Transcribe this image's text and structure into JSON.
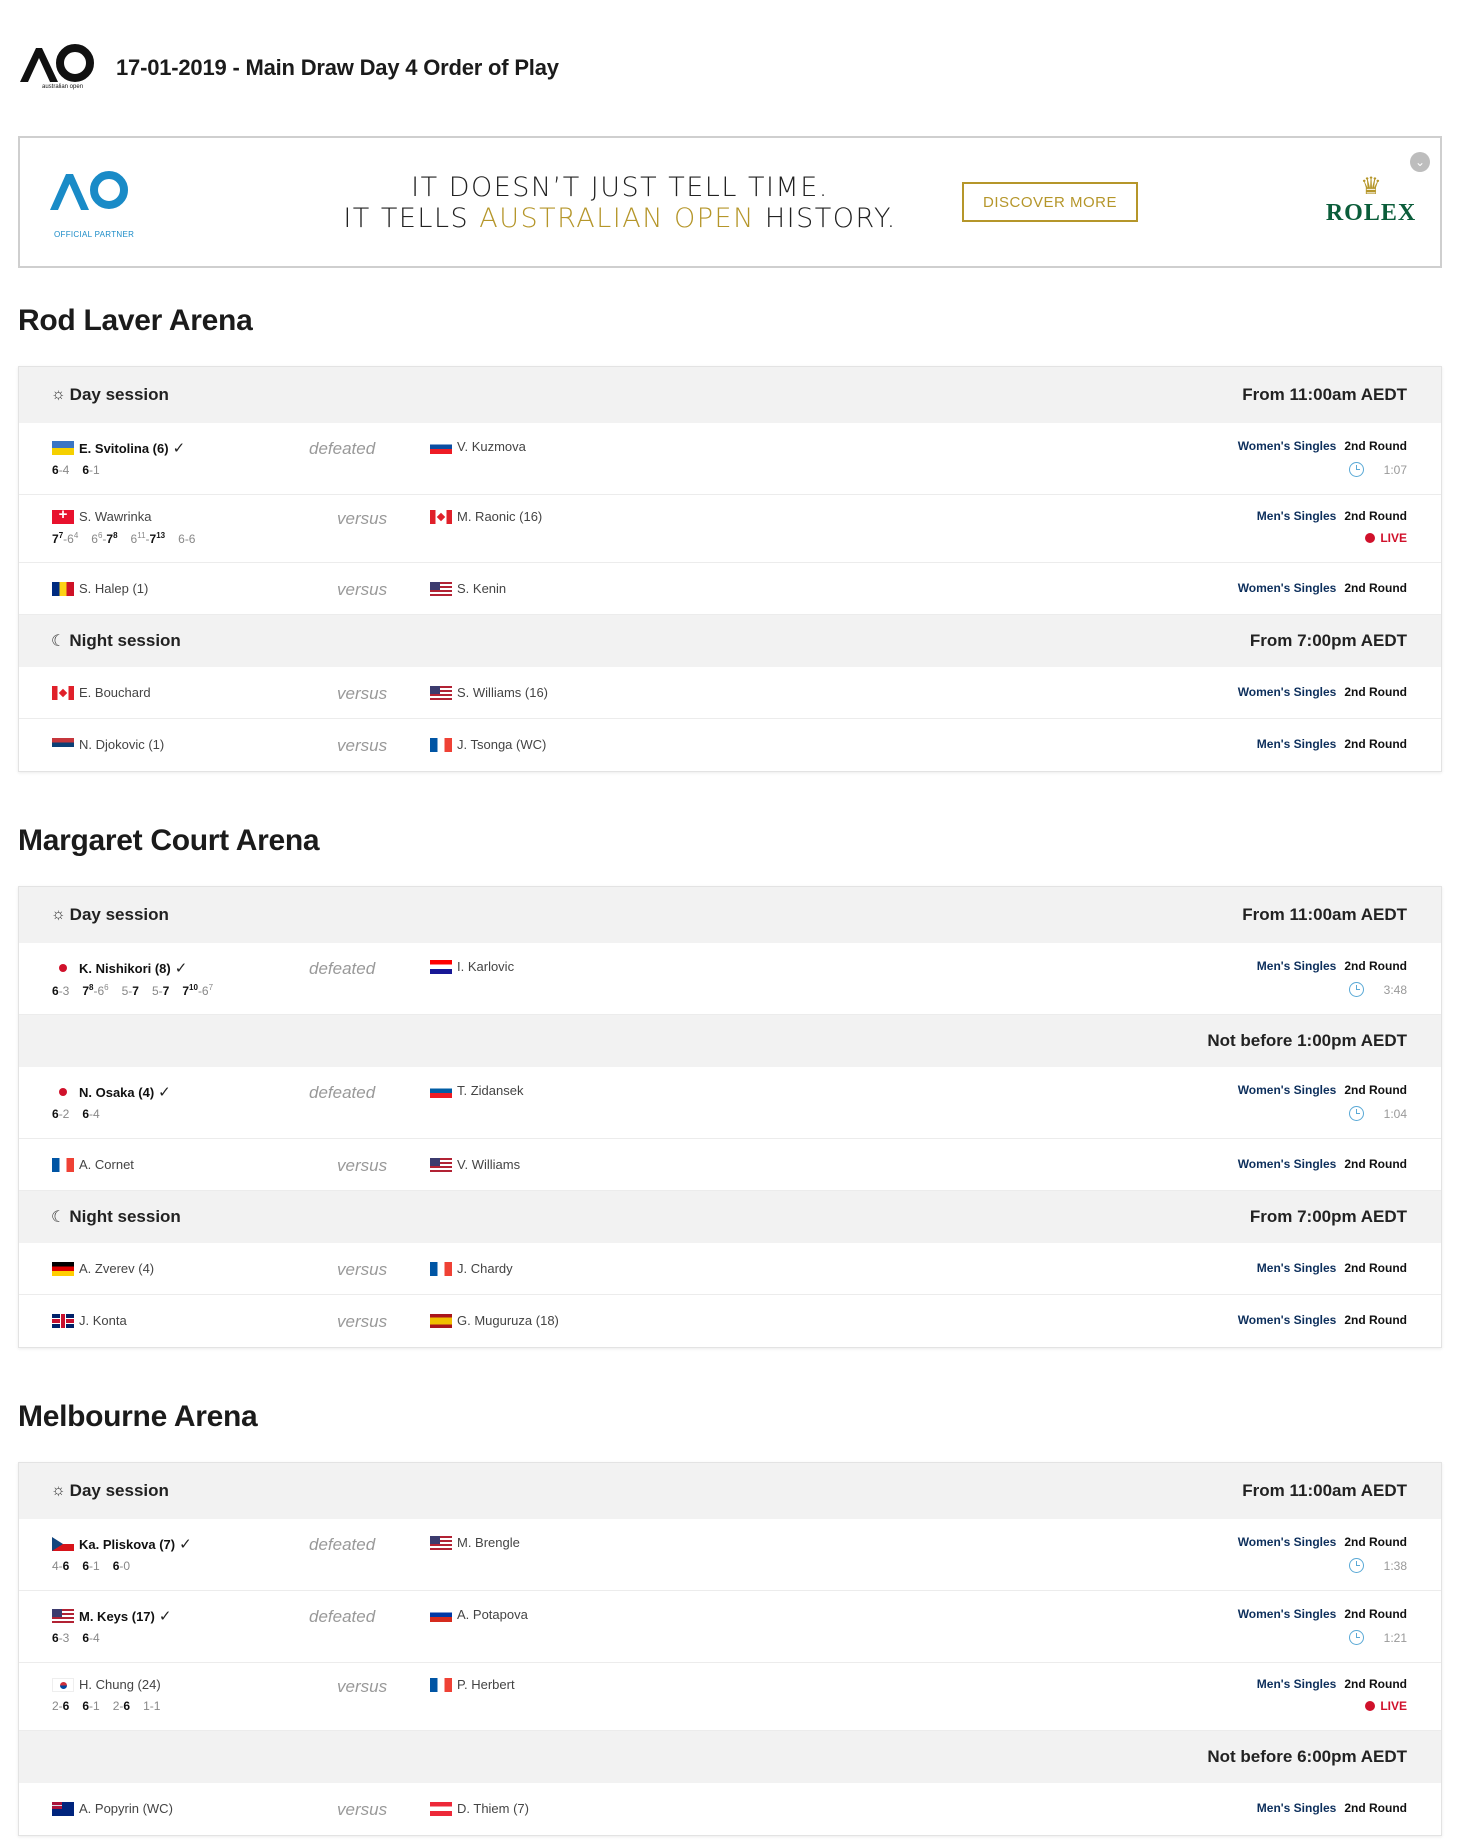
{
  "header": {
    "title": "17-01-2019 - Main Draw Day 4 Order of Play",
    "logo_text": "australian open"
  },
  "ad": {
    "logo_tag": "OFFICIAL PARTNER",
    "line1": "IT DOESN’T JUST TELL TIME.",
    "line2_a": "IT TELLS ",
    "line2_gold": "AUSTRALIAN OPEN",
    "line2_b": " HISTORY.",
    "cta": "DISCOVER MORE",
    "brand": "ROLEX",
    "brand_color": "#0b5d3a",
    "gold_color": "#b5962a"
  },
  "courts": {
    "rla": {
      "name": "Rod Laver Arena",
      "day": {
        "label": "Day session",
        "time": "From 11:00am AEDT"
      },
      "night": {
        "label": "Night session",
        "time": "From 7:00pm AEDT"
      },
      "m1": {
        "p1": "E. Svitolina (6)",
        "result": "defeated",
        "p2": "V. Kuzmova",
        "event": "Women's Singles",
        "round": "2nd Round",
        "duration": "1:07"
      },
      "m2": {
        "p1": "S. Wawrinka",
        "result": "versus",
        "p2": "M. Raonic (16)",
        "event": "Men's Singles",
        "round": "2nd Round",
        "status": "LIVE"
      },
      "m3": {
        "p1": "S. Halep (1)",
        "result": "versus",
        "p2": "S. Kenin",
        "event": "Women's Singles",
        "round": "2nd Round"
      },
      "m4": {
        "p1": "E. Bouchard",
        "result": "versus",
        "p2": "S. Williams (16)",
        "event": "Women's Singles",
        "round": "2nd Round"
      },
      "m5": {
        "p1": "N. Djokovic (1)",
        "result": "versus",
        "p2": "J. Tsonga (WC)",
        "event": "Men's Singles",
        "round": "2nd Round"
      }
    },
    "mca": {
      "name": "Margaret Court Arena",
      "day": {
        "label": "Day session",
        "time": "From 11:00am AEDT"
      },
      "notbefore": {
        "time": "Not before 1:00pm AEDT"
      },
      "night": {
        "label": "Night session",
        "time": "From 7:00pm AEDT"
      },
      "m1": {
        "p1": "K. Nishikori (8)",
        "result": "defeated",
        "p2": "I. Karlovic",
        "event": "Men's Singles",
        "round": "2nd Round",
        "duration": "3:48"
      },
      "m2": {
        "p1": "N. Osaka (4)",
        "result": "defeated",
        "p2": "T. Zidansek",
        "event": "Women's Singles",
        "round": "2nd Round",
        "duration": "1:04"
      },
      "m3": {
        "p1": "A. Cornet",
        "result": "versus",
        "p2": "V. Williams",
        "event": "Women's Singles",
        "round": "2nd Round"
      },
      "m4": {
        "p1": "A. Zverev (4)",
        "result": "versus",
        "p2": "J. Chardy",
        "event": "Men's Singles",
        "round": "2nd Round"
      },
      "m5": {
        "p1": "J. Konta",
        "result": "versus",
        "p2": "G. Muguruza (18)",
        "event": "Women's Singles",
        "round": "2nd Round"
      }
    },
    "ma": {
      "name": "Melbourne Arena",
      "day": {
        "label": "Day session",
        "time": "From 11:00am AEDT"
      },
      "notbefore": {
        "time": "Not before 6:00pm AEDT"
      },
      "m1": {
        "p1": "Ka. Pliskova (7)",
        "result": "defeated",
        "p2": "M. Brengle",
        "event": "Women's Singles",
        "round": "2nd Round",
        "duration": "1:38"
      },
      "m2": {
        "p1": "M. Keys (17)",
        "result": "defeated",
        "p2": "A. Potapova",
        "event": "Women's Singles",
        "round": "2nd Round",
        "duration": "1:21"
      },
      "m3": {
        "p1": "H. Chung (24)",
        "result": "versus",
        "p2": "P. Herbert",
        "event": "Men's Singles",
        "round": "2nd Round",
        "status": "LIVE"
      },
      "m4": {
        "p1": "A. Popyrin (WC)",
        "result": "versus",
        "p2": "D. Thiem (7)",
        "event": "Men's Singles",
        "round": "2nd Round"
      }
    }
  },
  "colors": {
    "event_navy": "#0d2f5c",
    "live_red": "#d0112b",
    "clock_blue": "#5aa9d6"
  },
  "icons": {
    "day": "sun-icon",
    "night": "moon-icon",
    "winner": "check-icon",
    "duration": "clock-icon"
  }
}
